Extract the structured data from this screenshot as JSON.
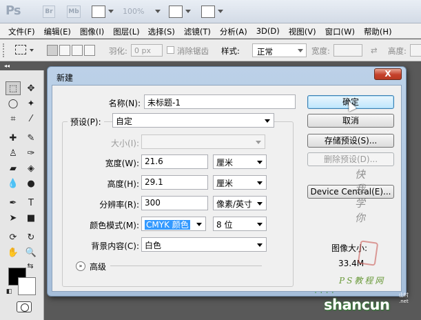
{
  "app": {
    "logo": "Ps",
    "br_icon": "Br",
    "mb_icon": "Mb",
    "zoom": "100%"
  },
  "menu": [
    "文件(F)",
    "编辑(E)",
    "图像(I)",
    "图层(L)",
    "选择(S)",
    "滤镜(T)",
    "分析(A)",
    "3D(D)",
    "视图(V)",
    "窗口(W)",
    "帮助(H)"
  ],
  "options": {
    "feather_label": "羽化:",
    "feather_value": "0 px",
    "antialias_label": "消除锯齿",
    "style_label": "样式:",
    "style_value": "正常",
    "width_label": "宽度:",
    "height_label": "高度:"
  },
  "tools_header": "◂◂",
  "dialog": {
    "title": "新建",
    "close_label": "X",
    "name_label": "名称(N):",
    "name_value": "未标题-1",
    "preset_label": "预设(P):",
    "preset_value": "自定",
    "size_label": "大小(I):",
    "size_value": "",
    "width_label": "宽度(W):",
    "width_value": "21.6",
    "width_unit": "厘米",
    "height_label": "高度(H):",
    "height_value": "29.1",
    "height_unit": "厘米",
    "resolution_label": "分辨率(R):",
    "resolution_value": "300",
    "resolution_unit": "像素/英寸",
    "color_mode_label": "颜色模式(M):",
    "color_mode_value": "CMYK 颜色",
    "bit_depth_value": "8 位",
    "background_label": "背景内容(C):",
    "background_value": "白色",
    "advanced_label": "高级",
    "advanced_icon": "»",
    "buttons": {
      "ok": "确定",
      "cancel": "取消",
      "save_preset": "存储预设(S)...",
      "delete_preset": "删除预设(D)...",
      "device_central": "Device Central(E)..."
    },
    "image_size_label": "图像大小:",
    "image_size_value": "33.4M"
  },
  "watermark": {
    "handwriting": "快我学你",
    "ps_site": "PS教程网",
    "shancun": "shancun",
    "shancun_small": "山村\n.net"
  },
  "colors": {
    "dialog_frame": "#a6bed9",
    "close_button": "#c5412b",
    "default_button": "#bee6fd",
    "selection_highlight": "#3399ff"
  }
}
